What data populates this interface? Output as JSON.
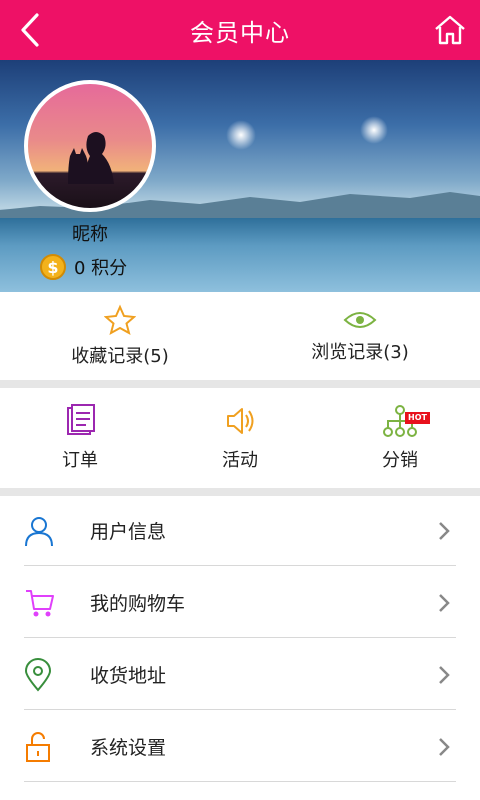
{
  "header": {
    "title": "会员中心",
    "back_icon": "back-arrow-icon",
    "home_icon": "home-icon",
    "bg_color": "#ee1166"
  },
  "profile": {
    "nickname": "昵称",
    "points_value": "0 积分",
    "coin_icon": "coin-icon"
  },
  "records": [
    {
      "label": "收藏记录(5)",
      "icon": "star-icon",
      "color": "#f0a020"
    },
    {
      "label": "浏览记录(3)",
      "icon": "eye-icon",
      "color": "#7cb342"
    }
  ],
  "shortcuts": [
    {
      "label": "订单",
      "icon": "order-icon",
      "color": "#9c27b0"
    },
    {
      "label": "活动",
      "icon": "speaker-icon",
      "color": "#f0a020"
    },
    {
      "label": "分销",
      "icon": "network-icon",
      "color": "#7cb342",
      "badge": "HOT"
    }
  ],
  "list": [
    {
      "label": "用户信息",
      "icon": "user-icon",
      "color": "#1976d2"
    },
    {
      "label": "我的购物车",
      "icon": "cart-icon",
      "color": "#e040fb"
    },
    {
      "label": "收货地址",
      "icon": "location-pin-icon",
      "color": "#388e3c"
    },
    {
      "label": "系统设置",
      "icon": "lock-icon",
      "color": "#f57c00"
    }
  ]
}
